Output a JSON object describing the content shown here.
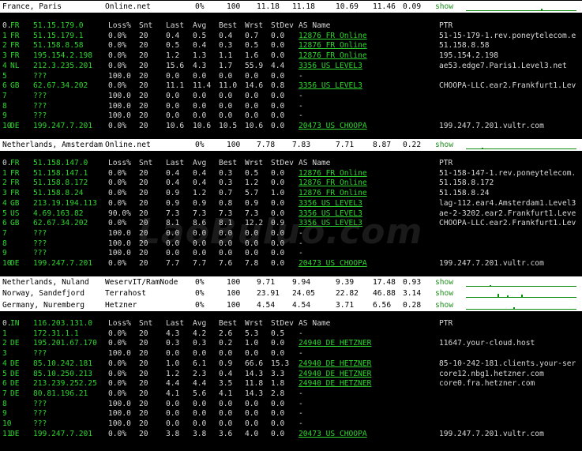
{
  "colors": {
    "hop_text": "#2ed52e",
    "as_link": "#2ed52e",
    "background": "#000000",
    "header_bg": "#ffffff"
  },
  "watermark": "LaoBuluo.com",
  "blocks": [
    {
      "header": {
        "location": "France, Paris",
        "provider": "Online.net",
        "loss": "0%",
        "snt": "100",
        "last": "11.18",
        "avg": "11.18",
        "best": "10.69",
        "wrst": "11.46",
        "stdev": "0.09",
        "action": "show"
      },
      "colhead": {
        "hop": "0.",
        "cc": "FR",
        "host": "51.15.179.0",
        "loss": "Loss%",
        "snt": "Snt",
        "last": "Last",
        "avg": "Avg",
        "best": "Best",
        "wrst": "Wrst",
        "stdev": "StDev",
        "as": "AS Name",
        "ptr": "PTR"
      },
      "hops": [
        {
          "hop": "1",
          "cc": "FR",
          "host": "51.15.179.1",
          "loss": "0.0%",
          "snt": "20",
          "last": "0.4",
          "avg": "0.5",
          "best": "0.4",
          "wrst": "0.7",
          "stdev": "0.0",
          "as": "12876 FR Online",
          "ptr": "51-15-179-1.rev.poneytelecom.e"
        },
        {
          "hop": "2",
          "cc": "FR",
          "host": "51.158.8.58",
          "loss": "0.0%",
          "snt": "20",
          "last": "0.5",
          "avg": "0.4",
          "best": "0.3",
          "wrst": "0.5",
          "stdev": "0.0",
          "as": "12876 FR Online",
          "ptr": "51.158.8.58"
        },
        {
          "hop": "3",
          "cc": "FR",
          "host": "195.154.2.198",
          "loss": "0.0%",
          "snt": "20",
          "last": "1.2",
          "avg": "1.3",
          "best": "1.1",
          "wrst": "1.6",
          "stdev": "0.0",
          "as": "12876 FR Online",
          "ptr": "195.154.2.198"
        },
        {
          "hop": "4",
          "cc": "NL",
          "host": "212.3.235.201",
          "loss": "0.0%",
          "snt": "20",
          "last": "15.6",
          "avg": "4.3",
          "best": "1.7",
          "wrst": "55.9",
          "stdev": "4.4",
          "as": "3356  US LEVEL3",
          "ptr": "ae53.edge7.Paris1.Level3.net"
        },
        {
          "hop": "5",
          "cc": "",
          "host": "???",
          "loss": "100.0",
          "snt": "20",
          "last": "0.0",
          "avg": "0.0",
          "best": "0.0",
          "wrst": "0.0",
          "stdev": "0.0",
          "as": "-",
          "ptr": ""
        },
        {
          "hop": "6",
          "cc": "GB",
          "host": "62.67.34.202",
          "loss": "0.0%",
          "snt": "20",
          "last": "11.1",
          "avg": "11.4",
          "best": "11.0",
          "wrst": "14.6",
          "stdev": "0.8",
          "as": "3356  US LEVEL3",
          "ptr": "CHOOPA-LLC.ear2.Frankfurt1.Lev"
        },
        {
          "hop": "7",
          "cc": "",
          "host": "???",
          "loss": "100.0",
          "snt": "20",
          "last": "0.0",
          "avg": "0.0",
          "best": "0.0",
          "wrst": "0.0",
          "stdev": "0.0",
          "as": "-",
          "ptr": ""
        },
        {
          "hop": "8",
          "cc": "",
          "host": "???",
          "loss": "100.0",
          "snt": "20",
          "last": "0.0",
          "avg": "0.0",
          "best": "0.0",
          "wrst": "0.0",
          "stdev": "0.0",
          "as": "-",
          "ptr": ""
        },
        {
          "hop": "9",
          "cc": "",
          "host": "???",
          "loss": "100.0",
          "snt": "20",
          "last": "0.0",
          "avg": "0.0",
          "best": "0.0",
          "wrst": "0.0",
          "stdev": "0.0",
          "as": "-",
          "ptr": ""
        },
        {
          "hop": "10",
          "cc": "DE",
          "host": "199.247.7.201",
          "loss": "0.0%",
          "snt": "20",
          "last": "10.6",
          "avg": "10.6",
          "best": "10.5",
          "wrst": "10.6",
          "stdev": "0.0",
          "as": "20473 US CHOOPA",
          "ptr": "199.247.7.201.vultr.com"
        }
      ]
    },
    {
      "header": {
        "location": "Netherlands, Amsterdam",
        "provider": "Online.net",
        "loss": "0%",
        "snt": "100",
        "last": "7.78",
        "avg": "7.83",
        "best": "7.71",
        "wrst": "8.87",
        "stdev": "0.22",
        "action": "show"
      },
      "colhead": {
        "hop": "0.",
        "cc": "FR",
        "host": "51.158.147.0",
        "loss": "Loss%",
        "snt": "Snt",
        "last": "Last",
        "avg": "Avg",
        "best": "Best",
        "wrst": "Wrst",
        "stdev": "StDev",
        "as": "AS Name",
        "ptr": "PTR"
      },
      "hops": [
        {
          "hop": "1",
          "cc": "FR",
          "host": "51.158.147.1",
          "loss": "0.0%",
          "snt": "20",
          "last": "0.4",
          "avg": "0.4",
          "best": "0.3",
          "wrst": "0.5",
          "stdev": "0.0",
          "as": "12876 FR Online",
          "ptr": "51-158-147-1.rev.poneytelecom."
        },
        {
          "hop": "2",
          "cc": "FR",
          "host": "51.158.8.172",
          "loss": "0.0%",
          "snt": "20",
          "last": "0.4",
          "avg": "0.4",
          "best": "0.3",
          "wrst": "1.2",
          "stdev": "0.0",
          "as": "12876 FR Online",
          "ptr": "51.158.8.172"
        },
        {
          "hop": "3",
          "cc": "FR",
          "host": "51.158.8.24",
          "loss": "0.0%",
          "snt": "20",
          "last": "0.9",
          "avg": "1.2",
          "best": "0.7",
          "wrst": "5.7",
          "stdev": "1.0",
          "as": "12876 FR Online",
          "ptr": "51.158.8.24"
        },
        {
          "hop": "4",
          "cc": "GB",
          "host": "213.19.194.113",
          "loss": "0.0%",
          "snt": "20",
          "last": "0.9",
          "avg": "0.9",
          "best": "0.8",
          "wrst": "0.9",
          "stdev": "0.0",
          "as": "3356  US LEVEL3",
          "ptr": "lag-112.ear4.Amsterdam1.Level3"
        },
        {
          "hop": "5",
          "cc": "US",
          "host": "4.69.163.82",
          "loss": "90.0%",
          "snt": "20",
          "last": "7.3",
          "avg": "7.3",
          "best": "7.3",
          "wrst": "7.3",
          "stdev": "0.0",
          "as": "3356  US LEVEL3",
          "ptr": "ae-2-3202.ear2.Frankfurt1.Leve"
        },
        {
          "hop": "6",
          "cc": "GB",
          "host": "62.67.34.202",
          "loss": "0.0%",
          "snt": "20",
          "last": "8.1",
          "avg": "8.6",
          "best": "8.1",
          "wrst": "12.2",
          "stdev": "0.9",
          "as": "3356  US LEVEL3",
          "ptr": "CHOOPA-LLC.ear2.Frankfurt1.Lev"
        },
        {
          "hop": "7",
          "cc": "",
          "host": "???",
          "loss": "100.0",
          "snt": "20",
          "last": "0.0",
          "avg": "0.0",
          "best": "0.0",
          "wrst": "0.0",
          "stdev": "0.0",
          "as": "-",
          "ptr": ""
        },
        {
          "hop": "8",
          "cc": "",
          "host": "???",
          "loss": "100.0",
          "snt": "20",
          "last": "0.0",
          "avg": "0.0",
          "best": "0.0",
          "wrst": "0.0",
          "stdev": "0.0",
          "as": "-",
          "ptr": ""
        },
        {
          "hop": "9",
          "cc": "",
          "host": "???",
          "loss": "100.0",
          "snt": "20",
          "last": "0.0",
          "avg": "0.0",
          "best": "0.0",
          "wrst": "0.0",
          "stdev": "0.0",
          "as": "-",
          "ptr": ""
        },
        {
          "hop": "10",
          "cc": "DE",
          "host": "199.247.7.201",
          "loss": "0.0%",
          "snt": "20",
          "last": "7.7",
          "avg": "7.7",
          "best": "7.6",
          "wrst": "7.8",
          "stdev": "0.0",
          "as": "20473 US CHOOPA",
          "ptr": "199.247.7.201.vultr.com"
        }
      ]
    }
  ],
  "summary_rows": [
    {
      "location": "Netherlands, Nuland",
      "provider": "WeservIT/RamNode",
      "loss": "0%",
      "snt": "100",
      "last": "9.71",
      "avg": "9.94",
      "best": "9.39",
      "wrst": "17.48",
      "stdev": "0.93",
      "action": "show"
    },
    {
      "location": "Norway, Sandefjord",
      "provider": "Terrahost",
      "loss": "0%",
      "snt": "100",
      "last": "23.91",
      "avg": "24.05",
      "best": "22.82",
      "wrst": "46.88",
      "stdev": "3.14",
      "action": "show"
    },
    {
      "location": "Germany, Nuremberg",
      "provider": "Hetzner",
      "loss": "0%",
      "snt": "100",
      "last": "4.54",
      "avg": "4.54",
      "best": "3.71",
      "wrst": "6.56",
      "stdev": "0.28",
      "action": "show"
    }
  ],
  "block3": {
    "colhead": {
      "hop": "0.",
      "cc": "IN",
      "host": "116.203.131.0",
      "loss": "Loss%",
      "snt": "Snt",
      "last": "Last",
      "avg": "Avg",
      "best": "Best",
      "wrst": "Wrst",
      "stdev": "StDev",
      "as": "AS Name",
      "ptr": "PTR"
    },
    "hops": [
      {
        "hop": "1",
        "cc": "",
        "host": "172.31.1.1",
        "loss": "0.0%",
        "snt": "20",
        "last": "4.3",
        "avg": "4.2",
        "best": "2.6",
        "wrst": "5.3",
        "stdev": "0.5",
        "as": "-",
        "ptr": ""
      },
      {
        "hop": "2",
        "cc": "DE",
        "host": "195.201.67.170",
        "loss": "0.0%",
        "snt": "20",
        "last": "0.3",
        "avg": "0.3",
        "best": "0.2",
        "wrst": "1.0",
        "stdev": "0.0",
        "as": "24940 DE HETZNER",
        "ptr": "11647.your-cloud.host"
      },
      {
        "hop": "3",
        "cc": "",
        "host": "???",
        "loss": "100.0",
        "snt": "20",
        "last": "0.0",
        "avg": "0.0",
        "best": "0.0",
        "wrst": "0.0",
        "stdev": "0.0",
        "as": "-",
        "ptr": ""
      },
      {
        "hop": "4",
        "cc": "DE",
        "host": "85.10.242.181",
        "loss": "0.0%",
        "snt": "20",
        "last": "1.0",
        "avg": "6.1",
        "best": "0.9",
        "wrst": "66.6",
        "stdev": "15.3",
        "as": "24940 DE HETZNER",
        "ptr": "85-10-242-181.clients.your-ser"
      },
      {
        "hop": "5",
        "cc": "DE",
        "host": "85.10.250.213",
        "loss": "0.0%",
        "snt": "20",
        "last": "1.2",
        "avg": "2.3",
        "best": "0.4",
        "wrst": "14.3",
        "stdev": "3.3",
        "as": "24940 DE HETZNER",
        "ptr": "core12.nbg1.hetzner.com"
      },
      {
        "hop": "6",
        "cc": "DE",
        "host": "213.239.252.25",
        "loss": "0.0%",
        "snt": "20",
        "last": "4.4",
        "avg": "4.4",
        "best": "3.5",
        "wrst": "11.8",
        "stdev": "1.8",
        "as": "24940 DE HETZNER",
        "ptr": "core0.fra.hetzner.com"
      },
      {
        "hop": "7",
        "cc": "DE",
        "host": "80.81.196.21",
        "loss": "0.0%",
        "snt": "20",
        "last": "4.1",
        "avg": "5.6",
        "best": "4.1",
        "wrst": "14.3",
        "stdev": "2.8",
        "as": "-",
        "ptr": ""
      },
      {
        "hop": "8",
        "cc": "",
        "host": "???",
        "loss": "100.0",
        "snt": "20",
        "last": "0.0",
        "avg": "0.0",
        "best": "0.0",
        "wrst": "0.0",
        "stdev": "0.0",
        "as": "-",
        "ptr": ""
      },
      {
        "hop": "9",
        "cc": "",
        "host": "???",
        "loss": "100.0",
        "snt": "20",
        "last": "0.0",
        "avg": "0.0",
        "best": "0.0",
        "wrst": "0.0",
        "stdev": "0.0",
        "as": "-",
        "ptr": ""
      },
      {
        "hop": "10",
        "cc": "",
        "host": "???",
        "loss": "100.0",
        "snt": "20",
        "last": "0.0",
        "avg": "0.0",
        "best": "0.0",
        "wrst": "0.0",
        "stdev": "0.0",
        "as": "-",
        "ptr": ""
      },
      {
        "hop": "11",
        "cc": "DE",
        "host": "199.247.7.201",
        "loss": "0.0%",
        "snt": "20",
        "last": "3.8",
        "avg": "3.8",
        "best": "3.6",
        "wrst": "4.0",
        "stdev": "0.0",
        "as": "20473 US CHOOPA",
        "ptr": "199.247.7.201.vultr.com"
      }
    ]
  }
}
